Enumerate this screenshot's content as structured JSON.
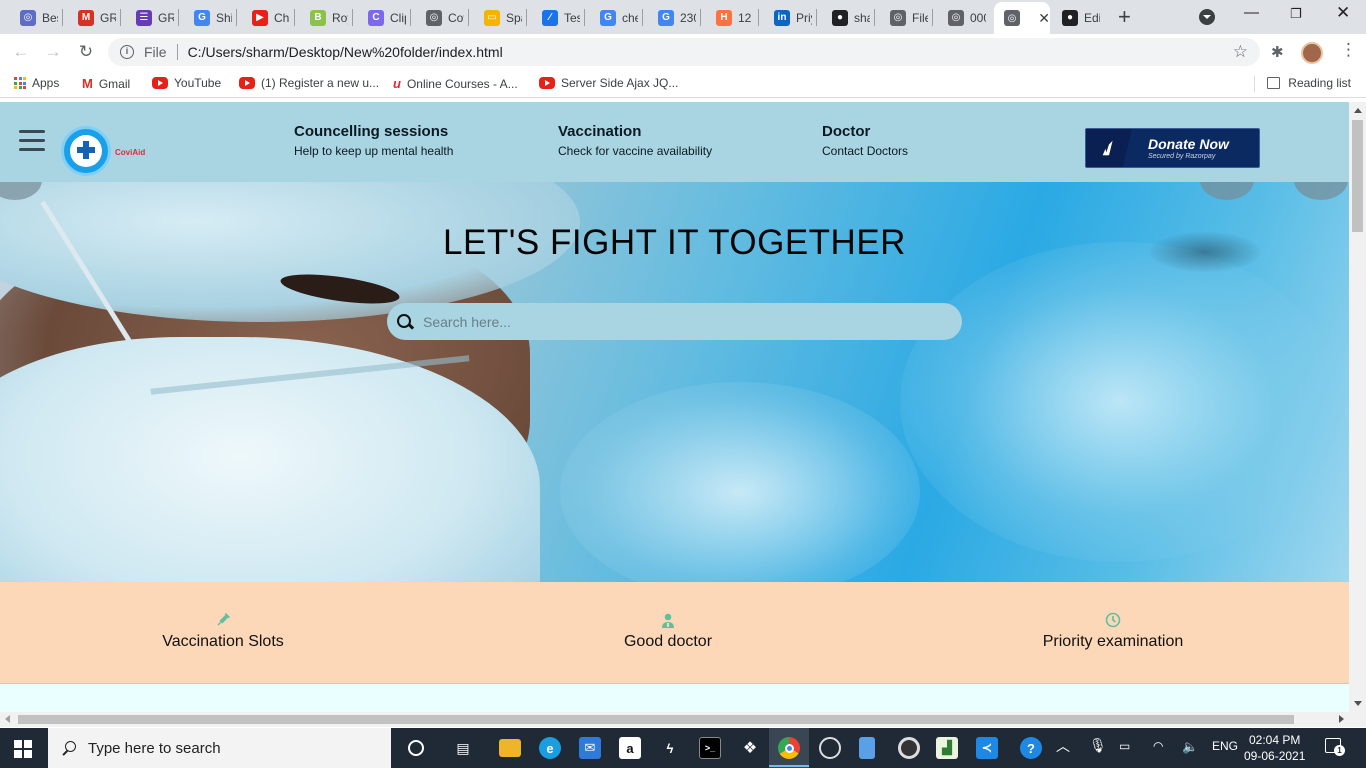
{
  "browser": {
    "tabs": [
      {
        "label": "Bes",
        "icon": "globe-icon",
        "color": "#5f6cc7"
      },
      {
        "label": "GRI",
        "icon": "gmail-icon",
        "color": "#d93025"
      },
      {
        "label": "GRI",
        "icon": "form-icon",
        "color": "#673ab7"
      },
      {
        "label": "Shi",
        "icon": "google-icon",
        "color": "#4285f4"
      },
      {
        "label": "Cha",
        "icon": "youtube-icon",
        "color": "#e62117"
      },
      {
        "label": "Roy",
        "icon": "b-icon",
        "color": "#8bc34a"
      },
      {
        "label": "Clip",
        "icon": "clip-icon",
        "color": "#7b68ee"
      },
      {
        "label": "Cov",
        "icon": "globe-icon",
        "color": "#5f6368"
      },
      {
        "label": "Spa",
        "icon": "folder-icon",
        "color": "#f4b400"
      },
      {
        "label": "Tes",
        "icon": "feather-icon",
        "color": "#1a73e8"
      },
      {
        "label": "che",
        "icon": "google-icon",
        "color": "#4285f4"
      },
      {
        "label": "230",
        "icon": "google-icon",
        "color": "#4285f4"
      },
      {
        "label": "12",
        "icon": "hackerrank-icon",
        "color": "#ff7043"
      },
      {
        "label": "Priy",
        "icon": "linkedin-icon",
        "color": "#0a66c2"
      },
      {
        "label": "sha",
        "icon": "github-icon",
        "color": "#202124"
      },
      {
        "label": "File",
        "icon": "globe-icon",
        "color": "#5f6368"
      },
      {
        "label": "000",
        "icon": "globe-icon",
        "color": "#5f6368"
      },
      {
        "label": "",
        "icon": "globe-icon",
        "color": "#5f6368",
        "active": true
      },
      {
        "label": "Edi",
        "icon": "github-icon",
        "color": "#202124"
      }
    ],
    "url_scheme": "File",
    "url": "C:/Users/sharm/Desktop/New%20folder/index.html",
    "bookmarks": [
      {
        "label": "Apps",
        "icon": "apps-grid-icon"
      },
      {
        "label": "Gmail",
        "icon": "gmail-icon"
      },
      {
        "label": "YouTube",
        "icon": "youtube-icon"
      },
      {
        "label": "(1) Register a new u...",
        "icon": "youtube-icon"
      },
      {
        "label": "Online Courses - A...",
        "icon": "udemy-icon"
      },
      {
        "label": "Server Side Ajax JQ...",
        "icon": "youtube-icon"
      }
    ],
    "reading_list": "Reading list"
  },
  "site": {
    "logo_text": "CoviAid",
    "nav": [
      {
        "title": "Councelling sessions",
        "subtitle": "Help to keep up mental health"
      },
      {
        "title": "Vaccination",
        "subtitle": "Check for vaccine availability"
      },
      {
        "title": "Doctor",
        "subtitle": "Contact Doctors"
      }
    ],
    "donate": {
      "label": "Donate Now",
      "sub": "Secured by Razorpay"
    },
    "hero_title": "LET'S FIGHT IT TOGETHER",
    "search_placeholder": "Search here...",
    "features": [
      {
        "label": "Vaccination Slots",
        "icon": "syringe-icon"
      },
      {
        "label": "Good doctor",
        "icon": "doctor-icon"
      },
      {
        "label": "Priority examination",
        "icon": "clock-icon"
      }
    ],
    "colors": {
      "nav_bg": "#a9d5e2",
      "feature_bg": "#fdd8b8",
      "icon_teal": "#5fbf9f"
    }
  },
  "taskbar": {
    "search_placeholder": "Type here to search",
    "language": "ENG",
    "time": "02:04 PM",
    "date": "09-06-2021",
    "notification_count": "1"
  }
}
